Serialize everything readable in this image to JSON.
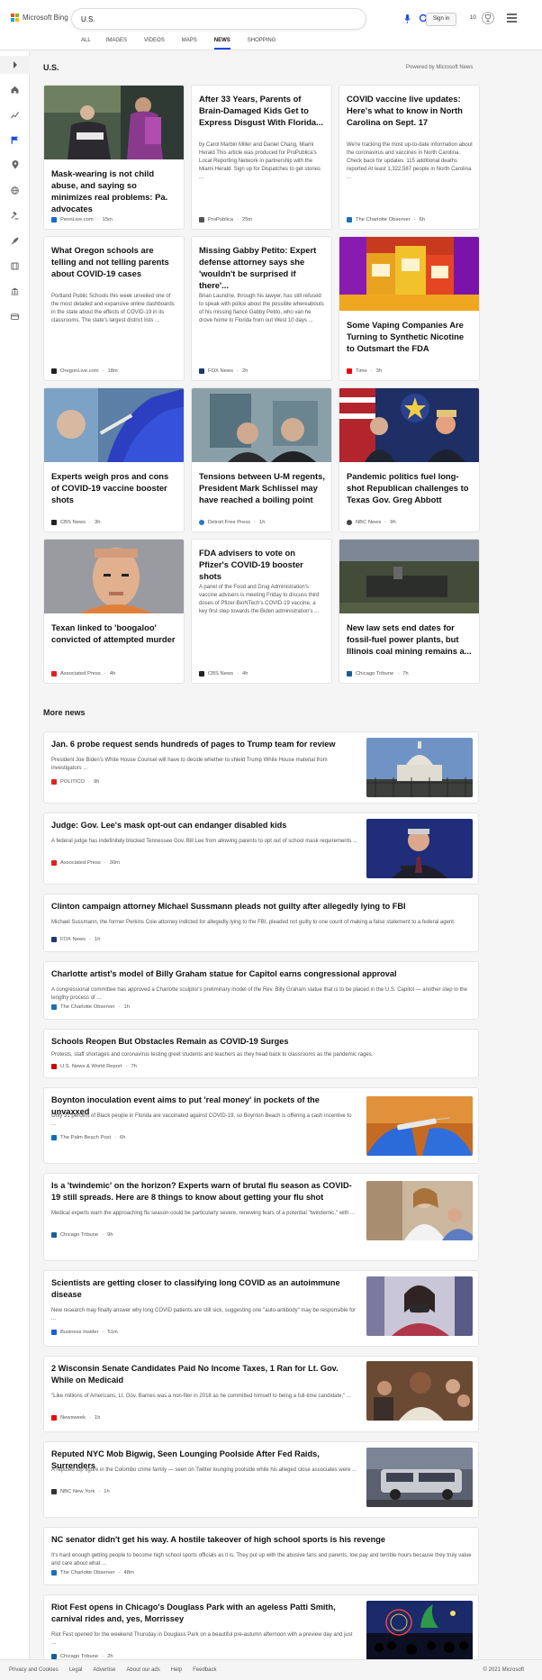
{
  "header": {
    "brand": "Microsoft Bing",
    "query": "U.S.",
    "signin": "Sign in",
    "rewards": "10"
  },
  "tabs": [
    "ALL",
    "IMAGES",
    "VIDEOS",
    "MAPS",
    "NEWS",
    "SHOPPING"
  ],
  "active_tab": "NEWS",
  "section": {
    "title": "U.S.",
    "powered": "Powered by Microsoft News"
  },
  "cards": [
    {
      "title": "Mask-wearing is not child abuse, and saying so minimizes real problems: Pa. advocates",
      "excerpt": "",
      "source": "PennLive.com",
      "time": "15m",
      "fav": "#1b6ad1"
    },
    {
      "title": "After 33 Years, Parents of Brain-Damaged Kids Get to Express Disgust With Florida...",
      "excerpt": "by Carol Marbin Miller and Daniel Chang, Miami Herald This article was produced for ProPublica's Local Reporting Network in partnership with the Miami Herald. Sign up for Dispatches to get stories ...",
      "source": "ProPublica",
      "time": "25m",
      "fav": "#555"
    },
    {
      "title": "COVID vaccine live updates: Here's what to know in North Carolina on Sept. 17",
      "excerpt": "We're tracking the most up-to-date information about the coronavirus and vaccines in North Carolina. Check back for updates. 115 additional deaths reported At least 1,322,587 people in North Carolina ...",
      "source": "The Charlotte Observer",
      "time": "6h",
      "fav": "#1c6fb5"
    },
    {
      "title": "What Oregon schools are telling and not telling parents about COVID-19 cases",
      "excerpt": "Portland Public Schools this week unveiled one of the most detailed and expansive online dashboards in the state about the effects of COVID-19 in its classrooms. The state's largest district lists ...",
      "source": "OregonLive.com",
      "time": "18m",
      "fav": "#222"
    },
    {
      "title": "Missing Gabby Petito: Expert defense attorney says she 'wouldn't be surprised if there'...",
      "excerpt": "Brian Laundrie, through his lawyer, has still refused to speak with police about the possible whereabouts of his missing fiancé Gabby Petito, who van he drove home to Florida from out West 10 days ...",
      "source": "FOX News",
      "time": "2h",
      "fav": "#1a3a6b"
    },
    {
      "title": "Some Vaping Companies Are Turning to Synthetic Nicotine to Outsmart the FDA",
      "excerpt": "",
      "source": "Time",
      "time": "3h",
      "fav": "#e00"
    },
    {
      "title": "Experts weigh pros and cons of COVID-19 vaccine booster shots",
      "excerpt": "",
      "source": "CBS News",
      "time": "3h",
      "fav": "#222"
    },
    {
      "title": "Tensions between U-M regents, President Mark Schlissel may have reached a boiling point",
      "excerpt": "",
      "source": "Detroit Free Press",
      "time": "1h",
      "fav": "#2a7ac0"
    },
    {
      "title": "Pandemic politics fuel long-shot Republican challenges to Texas Gov. Greg Abbott",
      "excerpt": "",
      "source": "NBC News",
      "time": "9h",
      "fav": "#444"
    },
    {
      "title": "Texan linked to 'boogaloo' convicted of attempted murder",
      "excerpt": "",
      "source": "Associated Press",
      "time": "4h",
      "fav": "#d22"
    },
    {
      "title": "FDA advisers to vote on Pfizer's COVID-19 booster shots",
      "excerpt": "A panel of the Food and Drug Administration's vaccine advisers is meeting Friday to discuss third doses of Pfizer-BioNTech's COVID-19 vaccine, a key first step towards the Biden administration's ...",
      "source": "CBS News",
      "time": "4h",
      "fav": "#222"
    },
    {
      "title": "New law sets end dates for fossil-fuel power plants, but Illinois coal mining remains a...",
      "excerpt": "",
      "source": "Chicago Tribune",
      "time": "7h",
      "fav": "#1a5c9a"
    }
  ],
  "more": {
    "title": "More news",
    "items": [
      {
        "title": "Jan. 6 probe request sends hundreds of pages to Trump team for review",
        "excerpt": "President Joe Biden's White House Counsel will have to decide whether to shield Trump White House material from investigators ...",
        "source": "POLITICO",
        "time": "9h",
        "fav": "#d22"
      },
      {
        "title": "Judge: Gov. Lee's mask opt-out can endanger disabled kids",
        "excerpt": "A federal judge has indefinitely blocked Tennessee Gov. Bill Lee from allowing parents to opt out of school mask requirements ...",
        "source": "Associated Press",
        "time": "30m",
        "fav": "#d22"
      },
      {
        "title": "Clinton campaign attorney Michael Sussmann pleads not guilty after allegedly lying to FBI",
        "excerpt": "Michael Sussmann, the former Perkins Coie attorney indicted for allegedly lying to the FBI, pleaded not guilty to one count of making a false statement to a federal agent.",
        "source": "FOX News",
        "time": "1h",
        "fav": "#1a3a6b"
      },
      {
        "title": "Charlotte artist's model of Billy Graham statue for Capitol earns congressional approval",
        "excerpt": "A congressional committee has approved a Charlotte sculptor's preliminary model of the Rev. Billy Graham statue that is to be placed in the U.S. Capitol — another step in the lengthy process of ...",
        "source": "The Charlotte Observer",
        "time": "1h",
        "fav": "#1c6fb5"
      },
      {
        "title": "Schools Reopen But Obstacles Remain as COVID-19 Surges",
        "excerpt": "Protests, staff shortages and coronavirus testing greet students and teachers as they head back to classrooms as the pandemic rages.",
        "source": "U.S. News & World Report",
        "time": "7h",
        "fav": "#c00"
      },
      {
        "title": "Boynton inoculation event aims to put 'real money' in pockets of the unvaxxed",
        "excerpt": "Only 31 percent of Black people in Florida are vaccinated against COVID-19, so Boynton Beach is offering a cash incentive to ...",
        "source": "The Palm Beach Post",
        "time": "6h",
        "fav": "#0a6fc2"
      },
      {
        "title": "Is a 'twindemic' on the horizon? Experts warn of brutal flu season as COVID-19 still spreads. Here are 8 things to know about getting your flu shot",
        "excerpt": "Medical experts warn the approaching flu season could be particularly severe, renewing fears of a potential \"twindemic,\" with ...",
        "source": "Chicago Tribune",
        "time": "9h",
        "fav": "#1a5c9a"
      },
      {
        "title": "Scientists are getting closer to classifying long COVID as an autoimmune disease",
        "excerpt": "New research may finally answer why long COVID patients are still sick, suggesting one \"auto-antibody\" may be responsible for ...",
        "source": "Business Insider",
        "time": "51m",
        "fav": "#1e5bd6"
      },
      {
        "title": "2 Wisconsin Senate Candidates Paid No Income Taxes, 1 Ran for Lt. Gov. While on Medicaid",
        "excerpt": "\"Like millions of Americans, Lt. Gov. Barnes was a non-filer in 2018 as he committed himself to being a full-time candidate,\" ...",
        "source": "Newsweek",
        "time": "1h",
        "fav": "#e00"
      },
      {
        "title": "Reputed NYC Mob Bigwig, Seen Lounging Poolside After Fed Raids, Surrenders",
        "excerpt": "A reputed top figure in the Colombo crime family — seen on Twitter lounging poolside while his alleged close associates were ...",
        "source": "NBC New York",
        "time": "1h",
        "fav": "#333"
      },
      {
        "title": "NC senator didn't get his way. A hostile takeover of high school sports is his revenge",
        "excerpt": "It's hard enough getting people to become high school sports officials as it is. They put up with the abusive fans and parents, low pay and terrible hours because they truly value and care about what ...",
        "source": "The Charlotte Observer",
        "time": "48m",
        "fav": "#1c6fb5"
      },
      {
        "title": "Riot Fest opens in Chicago's Douglass Park with an ageless Patti Smith, carnival rides and, yes, Morrissey",
        "excerpt": "Riot Fest opened for the weekend Thursday in Douglass Park on a beautiful pre-autumn afternoon with a preview day and just ...",
        "source": "Chicago Tribune",
        "time": "2h",
        "fav": "#1a5c9a"
      }
    ]
  },
  "footer": {
    "links": [
      "Privacy and Cookies",
      "Legal",
      "Advertise",
      "About our ads",
      "Help",
      "Feedback"
    ],
    "copyright": "© 2021 Microsoft"
  }
}
